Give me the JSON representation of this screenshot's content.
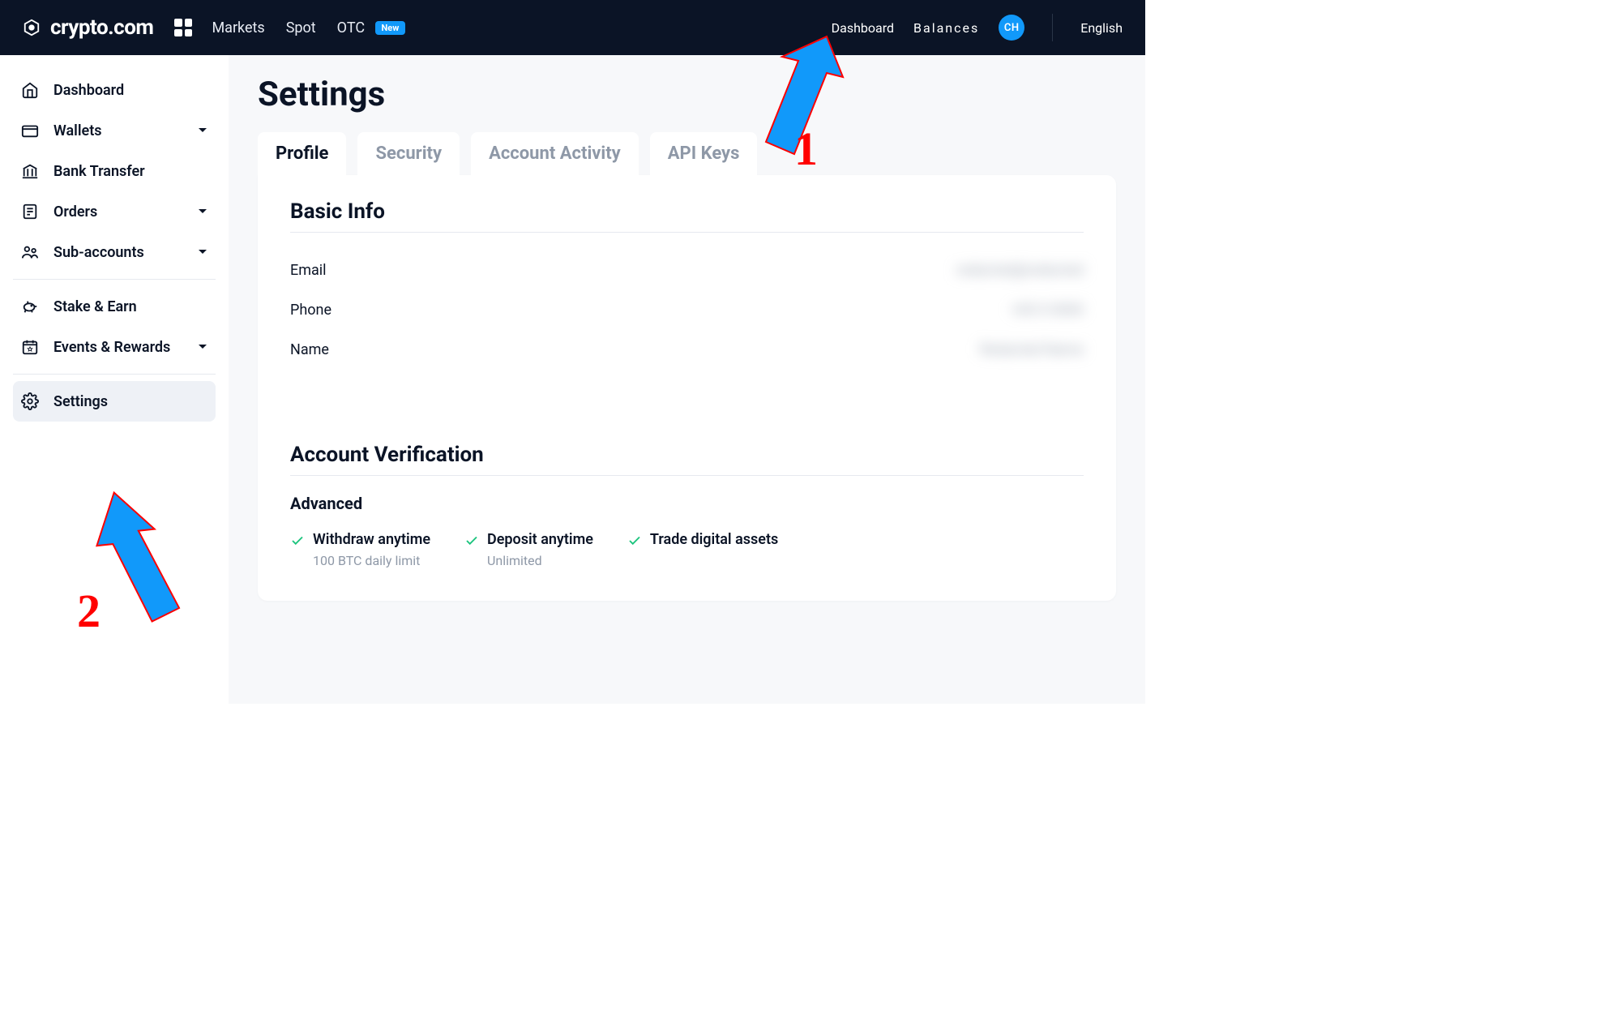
{
  "brand": {
    "name": "crypto.com"
  },
  "header": {
    "nav": {
      "markets": "Markets",
      "spot": "Spot",
      "otc": "OTC",
      "new_badge": "New"
    },
    "right": {
      "dashboard": "Dashboard",
      "balances": "Balances",
      "avatar_initials": "CH",
      "language": "English"
    }
  },
  "sidebar": {
    "dashboard": "Dashboard",
    "wallets": "Wallets",
    "bank_transfer": "Bank Transfer",
    "orders": "Orders",
    "sub_accounts": "Sub-accounts",
    "stake_earn": "Stake & Earn",
    "events_rewards": "Events & Rewards",
    "settings": "Settings"
  },
  "page": {
    "title": "Settings",
    "tabs": {
      "profile": "Profile",
      "security": "Security",
      "account_activity": "Account Activity",
      "api_keys": "API Keys"
    },
    "basic_info": {
      "heading": "Basic Info",
      "email_label": "Email",
      "email_value": "redacted@redacted",
      "phone_label": "Phone",
      "phone_value": "+00 0 0000",
      "name_label": "Name",
      "name_value": "Redacted Name"
    },
    "verification": {
      "heading": "Account Verification",
      "advanced": "Advanced",
      "features": {
        "withdraw": {
          "title": "Withdraw anytime",
          "sub": "100 BTC daily limit"
        },
        "deposit": {
          "title": "Deposit anytime",
          "sub": "Unlimited"
        },
        "trade": {
          "title": "Trade digital assets"
        }
      }
    }
  },
  "annotations": {
    "one": "1",
    "two": "2"
  }
}
